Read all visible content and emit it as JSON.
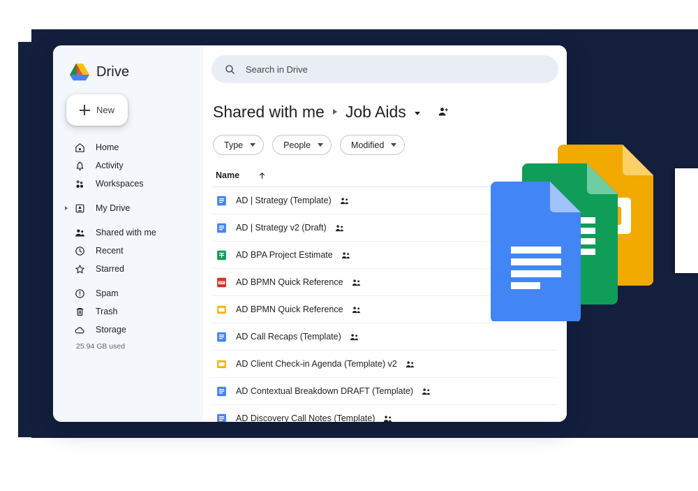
{
  "theme": {
    "navy": "#131f3c",
    "sidebar_bg": "#f4f7fb",
    "search_bg": "#e9edf4",
    "docs_blue": "#4285f4",
    "sheets_green": "#0f9d58",
    "slides_yellow": "#f4b400",
    "pdf_red": "#d93025",
    "text_primary": "#202124",
    "text_secondary": "#5f6368"
  },
  "sidebar": {
    "brand": {
      "label": "Drive",
      "logo_icon": "drive-logo-icon"
    },
    "new_button": {
      "label": "New",
      "icon": "plus-icon"
    },
    "groups": [
      {
        "items": [
          {
            "label": "Home",
            "icon": "home-icon"
          },
          {
            "label": "Activity",
            "icon": "bell-icon"
          },
          {
            "label": "Workspaces",
            "icon": "workspaces-icon"
          }
        ]
      },
      {
        "items": [
          {
            "label": "My Drive",
            "icon": "my-drive-icon",
            "expandable": true
          }
        ]
      },
      {
        "items": [
          {
            "label": "Shared with me",
            "icon": "people-icon"
          },
          {
            "label": "Recent",
            "icon": "clock-icon"
          },
          {
            "label": "Starred",
            "icon": "star-icon"
          }
        ]
      },
      {
        "items": [
          {
            "label": "Spam",
            "icon": "spam-icon"
          },
          {
            "label": "Trash",
            "icon": "trash-icon"
          },
          {
            "label": "Storage",
            "icon": "cloud-icon"
          }
        ]
      }
    ],
    "storage_used": "25.94 GB used"
  },
  "search": {
    "placeholder": "Search in Drive",
    "value": "",
    "icon": "search-icon"
  },
  "breadcrumb": {
    "root": "Shared with me",
    "current": "Job Aids",
    "separator_icon": "chevron-right-icon",
    "dropdown_icon": "chevron-down-icon",
    "share_icon": "person-add-icon"
  },
  "filters": [
    {
      "label": "Type",
      "icon": "chevron-down-icon"
    },
    {
      "label": "People",
      "icon": "chevron-down-icon"
    },
    {
      "label": "Modified",
      "icon": "chevron-down-icon"
    }
  ],
  "list": {
    "columns": [
      {
        "label": "Name",
        "sort_icon": "arrow-up-icon",
        "sorted": true
      }
    ],
    "rows": [
      {
        "name": "AD | Strategy (Template)",
        "icon": "google-docs-icon",
        "shared": true
      },
      {
        "name": "AD | Strategy v2 (Draft)",
        "icon": "google-docs-icon",
        "shared": true
      },
      {
        "name": "AD BPA Project Estimate",
        "icon": "google-sheets-icon",
        "shared": true
      },
      {
        "name": "AD BPMN Quick Reference",
        "icon": "pdf-icon",
        "shared": true
      },
      {
        "name": "AD BPMN Quick Reference",
        "icon": "google-slides-icon",
        "shared": true
      },
      {
        "name": "AD Call Recaps (Template)",
        "icon": "google-docs-icon",
        "shared": true
      },
      {
        "name": "AD Client Check-in Agenda (Template) v2",
        "icon": "google-slides-icon",
        "shared": true
      },
      {
        "name": "AD Contextual Breakdown DRAFT (Template)",
        "icon": "google-docs-icon",
        "shared": true
      },
      {
        "name": "AD Discovery Call Notes (Template)",
        "icon": "google-docs-icon",
        "shared": true
      }
    ]
  },
  "decorative": {
    "stacked_icons": [
      "google-slides-icon",
      "google-sheets-icon",
      "google-docs-icon"
    ]
  }
}
